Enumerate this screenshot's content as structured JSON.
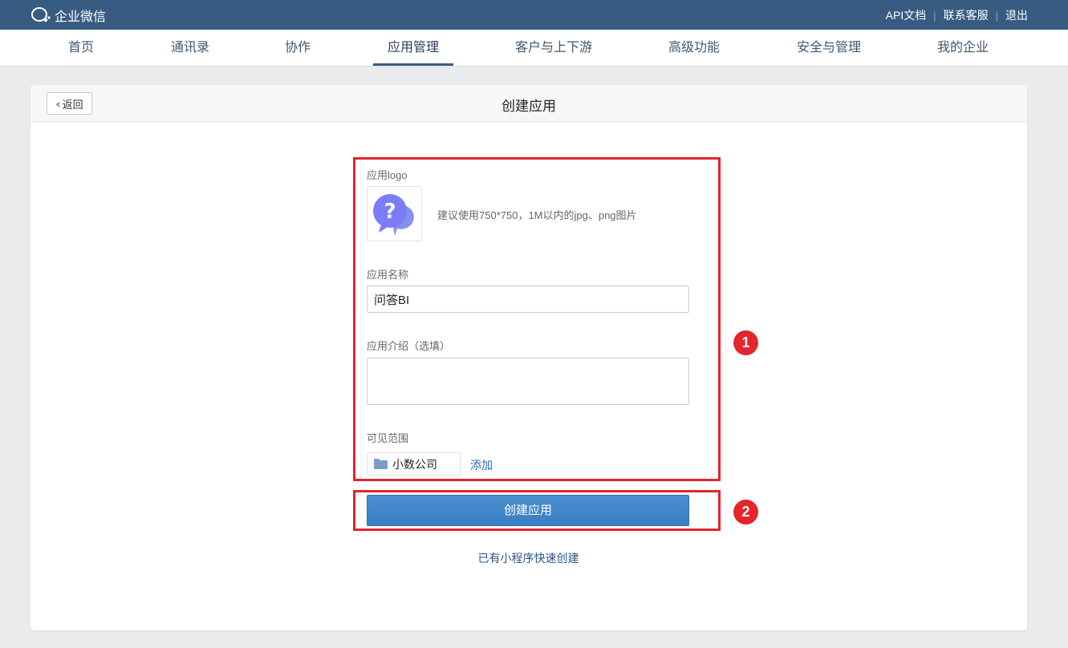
{
  "brand": {
    "name": "企业微信",
    "icon": "wework-logo-icon"
  },
  "top_links": [
    "API文档",
    "联系客服",
    "退出"
  ],
  "nav": {
    "items": [
      "首页",
      "通讯录",
      "协作",
      "应用管理",
      "客户与上下游",
      "高级功能",
      "安全与管理",
      "我的企业"
    ],
    "active": "应用管理"
  },
  "header": {
    "back_label": "返回",
    "title": "创建应用"
  },
  "form": {
    "logo_label": "应用logo",
    "logo_hint": "建议使用750*750，1M以内的jpg、png图片",
    "logo_icon": "question-chat-icon",
    "name_label": "应用名称",
    "name_value": "问答BI",
    "intro_label": "应用介绍（选填）",
    "intro_value": "",
    "scope_label": "可见范围",
    "scope_tag": "小数公司",
    "scope_icon": "folder-icon",
    "add_label": "添加",
    "submit_label": "创建应用",
    "mini_program_link": "已有小程序快速创建"
  },
  "annotations": {
    "badge1": "1",
    "badge2": "2",
    "highlight_color": "#e5242b"
  },
  "colors": {
    "topbar": "#385b82",
    "primary": "#3a7fc2",
    "link": "#2b6cb0"
  }
}
